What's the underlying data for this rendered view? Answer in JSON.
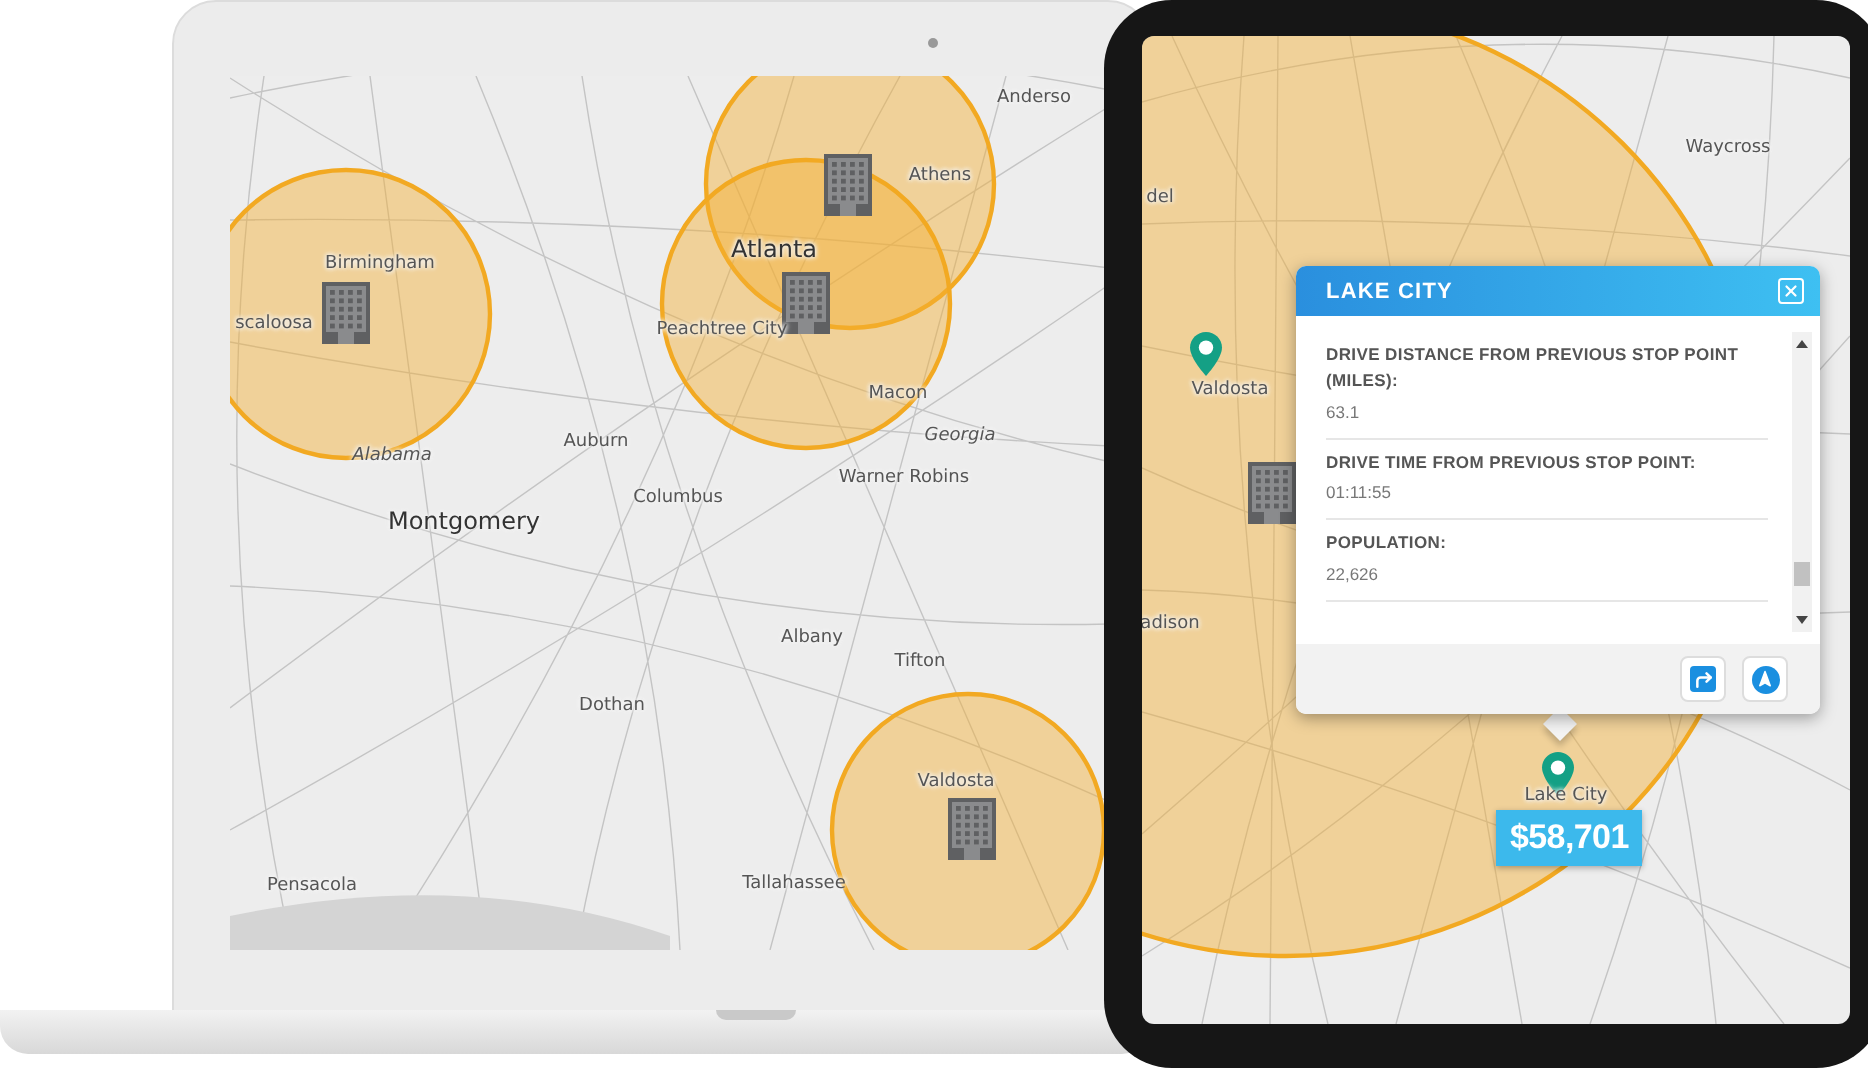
{
  "laptop": {
    "map_labels": [
      {
        "text": "Anderso",
        "kind": "city"
      },
      {
        "text": "Athens",
        "kind": "city"
      },
      {
        "text": "Atlanta",
        "kind": "major"
      },
      {
        "text": "Birmingham",
        "kind": "city"
      },
      {
        "text": "scaloosa",
        "kind": "city"
      },
      {
        "text": "Peachtree City",
        "kind": "city"
      },
      {
        "text": "Macon",
        "kind": "city"
      },
      {
        "text": "Georgia",
        "kind": "state"
      },
      {
        "text": "Alabama",
        "kind": "state"
      },
      {
        "text": "Auburn",
        "kind": "city"
      },
      {
        "text": "Columbus",
        "kind": "city"
      },
      {
        "text": "Warner Robins",
        "kind": "city"
      },
      {
        "text": "Montgomery",
        "kind": "major"
      },
      {
        "text": "Albany",
        "kind": "city"
      },
      {
        "text": "Tifton",
        "kind": "city"
      },
      {
        "text": "Dothan",
        "kind": "city"
      },
      {
        "text": "Valdosta",
        "kind": "city"
      },
      {
        "text": "Pensacola",
        "kind": "city"
      },
      {
        "text": "Tallahassee",
        "kind": "city"
      }
    ]
  },
  "tablet": {
    "map_labels": [
      {
        "text": "del",
        "kind": "city"
      },
      {
        "text": "Waycross",
        "kind": "city"
      },
      {
        "text": "Valdosta",
        "kind": "city"
      },
      {
        "text": "adison",
        "kind": "city"
      },
      {
        "text": "Lake City",
        "kind": "city"
      }
    ],
    "popup": {
      "title": "LAKE CITY",
      "fields": [
        {
          "label": "DRIVE DISTANCE FROM PREVIOUS STOP POINT (MILES):",
          "value": "63.1"
        },
        {
          "label": "DRIVE TIME FROM PREVIOUS STOP POINT:",
          "value": "01:11:55"
        },
        {
          "label": "POPULATION:",
          "value": "22,626"
        }
      ]
    },
    "price_badge": "$58,701"
  }
}
